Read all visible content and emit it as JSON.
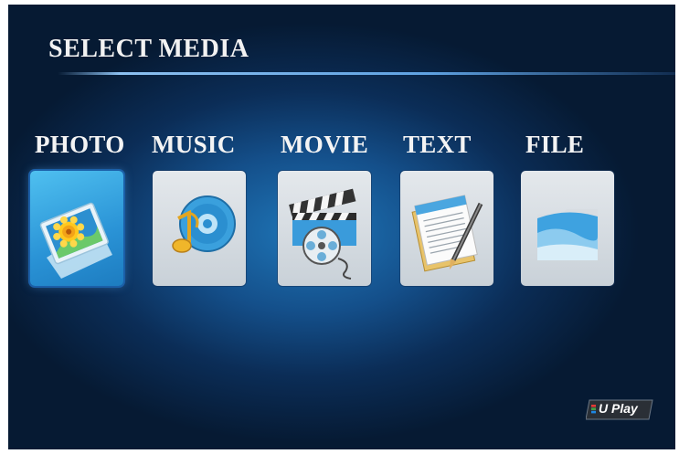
{
  "screen": {
    "title": "SELECT MEDIA",
    "selected_item": "PHOTO"
  },
  "media_items": [
    {
      "label": "PHOTO",
      "icon": "photo-icon"
    },
    {
      "label": "MUSIC",
      "icon": "music-icon"
    },
    {
      "label": "MOVIE",
      "icon": "movie-icon"
    },
    {
      "label": "TEXT",
      "icon": "text-icon"
    },
    {
      "label": "FILE",
      "icon": "file-icon"
    }
  ],
  "brand": {
    "logo_text": "U Play"
  },
  "colors": {
    "background_center": "#1f77b9",
    "background_edge": "#061a33",
    "accent_line": "#5fa2e2",
    "selected_tile": "#2a93d6"
  }
}
